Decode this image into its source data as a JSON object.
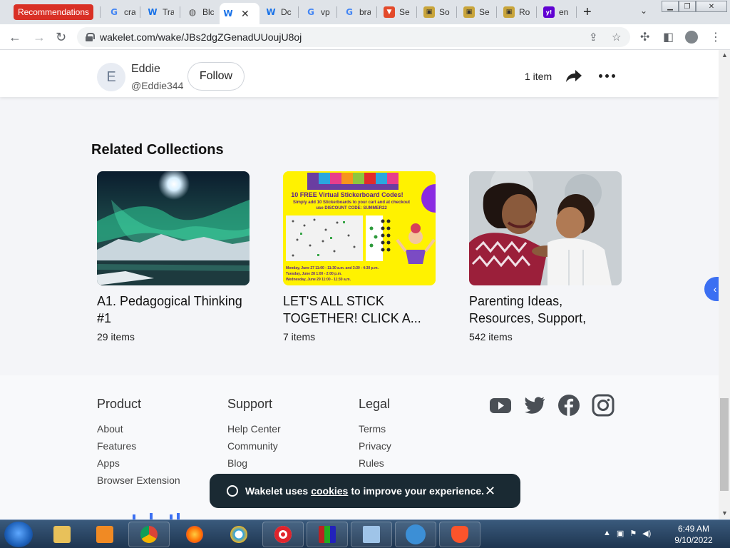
{
  "browser": {
    "recommendations_tab": "Recommendations",
    "tabs": [
      {
        "label": "cra",
        "icon": "google-icon"
      },
      {
        "label": "Tra",
        "icon": "wakelet-icon"
      },
      {
        "label": "Blc",
        "icon": "globe-icon"
      },
      {
        "label": "",
        "icon": "wakelet-icon",
        "active": true
      },
      {
        "label": "Dc",
        "icon": "wakelet-icon"
      },
      {
        "label": "vp",
        "icon": "google-icon"
      },
      {
        "label": "bra",
        "icon": "google-icon"
      },
      {
        "label": "Se",
        "icon": "brave-icon"
      },
      {
        "label": "So",
        "icon": "bag-icon"
      },
      {
        "label": "Se",
        "icon": "bag-icon"
      },
      {
        "label": "Ro",
        "icon": "bag-icon"
      },
      {
        "label": "en",
        "icon": "yahoo-icon"
      }
    ],
    "url": "wakelet.com/wake/JBs2dgZGenadUUoujU8oj"
  },
  "header": {
    "avatar_letter": "E",
    "author_name": "Eddie",
    "author_handle": "@Eddie344",
    "follow_label": "Follow",
    "item_count": "1 item"
  },
  "related": {
    "title": "Related Collections",
    "cards": [
      {
        "title": "A1. Pedagogical Thinking #1",
        "count": "29 items"
      },
      {
        "title": "LET'S ALL STICK TOGETHER! CLICK A...",
        "count": "7 items"
      },
      {
        "title": "Parenting Ideas, Resources, Support, and...",
        "count": "542 items"
      }
    ]
  },
  "sticker_image": {
    "headline": "10 FREE Virtual Stickerboard Codes!",
    "sub": "Simply add 10 Stickerboards to your cart and at checkout use DISCOUNT CODE: SUMMER22",
    "dates": [
      "Monday, June 27 11:00 - 11:30 a.m. and 3:30 - 4:30 p.m.",
      "Tuesday, June 28 1:00 - 2:00 p.m.",
      "Wednesday, June 29 11:00 - 11:30 a.m."
    ]
  },
  "footer": {
    "product": {
      "heading": "Product",
      "links": [
        "About",
        "Features",
        "Apps",
        "Browser Extension"
      ]
    },
    "support": {
      "heading": "Support",
      "links": [
        "Help Center",
        "Community",
        "Blog"
      ]
    },
    "legal": {
      "heading": "Legal",
      "links": [
        "Terms",
        "Privacy",
        "Rules"
      ]
    }
  },
  "cookie_banner": {
    "prefix": "Wakelet uses",
    "link": "cookies",
    "suffix": "to improve your experience."
  },
  "taskbar": {
    "time": "6:49 AM",
    "date": "9/10/2022"
  },
  "colors": {
    "accent_blue": "#3b6ff2",
    "recommendations_red": "#d93025",
    "cookie_bg": "#1a2a33"
  }
}
